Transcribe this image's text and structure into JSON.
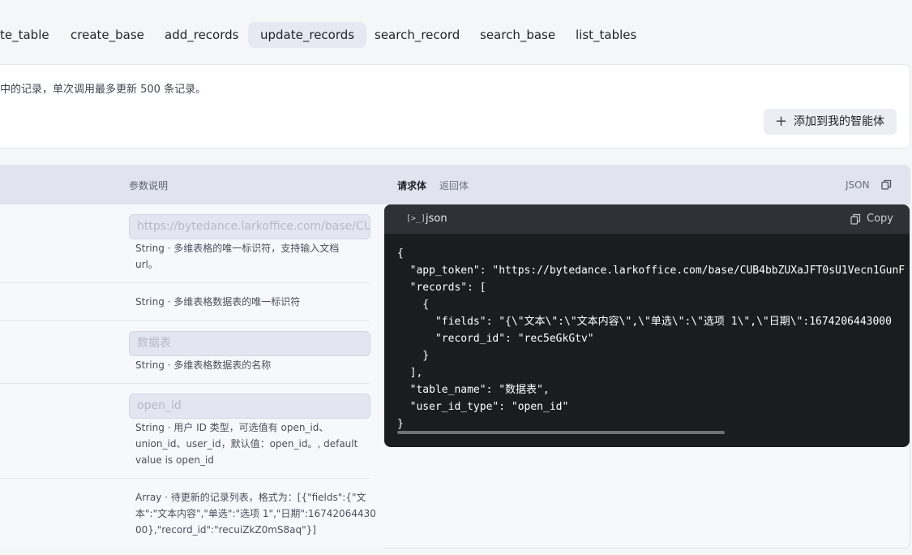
{
  "tabs": [
    {
      "label": "te_table"
    },
    {
      "label": "create_base"
    },
    {
      "label": "add_records"
    },
    {
      "label": "update_records",
      "active": true
    },
    {
      "label": "search_record"
    },
    {
      "label": "search_base"
    },
    {
      "label": "list_tables"
    }
  ],
  "description": "中的记录，单次调用最多更新 500 条记录。",
  "add_button": {
    "icon": "plus-icon",
    "label": "添加到我的智能体"
  },
  "panel": {
    "param_header": "参数说明",
    "request_tab": "请求体",
    "response_tab": "返回体",
    "format_label": "JSON"
  },
  "params": [
    {
      "placeholder": "https://bytedance.larkoffice.com/base/CUE",
      "desc": "String · 多维表格的唯一标识符，支持输入文档 url。"
    },
    {
      "desc": "String · 多维表格数据表的唯一标识符"
    },
    {
      "placeholder": "数据表",
      "desc": "String · 多维表格数据表的名称"
    },
    {
      "placeholder": "open_id",
      "desc": "String · 用户 ID 类型，可选值有 open_id、union_id、user_id，默认值：open_id。, default value is open_id"
    },
    {
      "desc": "Array · 待更新的记录列表，格式为：[{\"fields\":{\"文本\":\"文本内容\",\"单选\":\"选项 1\",\"日期\":1674206443000},\"record_id\":\"recuiZkZ0mS8aq\"}]"
    }
  ],
  "code": {
    "term_icon": "[>_]",
    "lang": "json",
    "copy_label": "Copy",
    "body": "{\n  \"app_token\": \"https://bytedance.larkoffice.com/base/CUB4bbZUXaJFT0sU1Vecn1GunF\n  \"records\": [\n    {\n      \"fields\": \"{\\\"文本\\\":\\\"文本内容\\\",\\\"单选\\\":\\\"选项 1\\\",\\\"日期\\\":1674206443000\n      \"record_id\": \"rec5eGkGtv\"\n    }\n  ],\n  \"table_name\": \"数据表\",\n  \"user_id_type\": \"open_id\"\n}"
  }
}
